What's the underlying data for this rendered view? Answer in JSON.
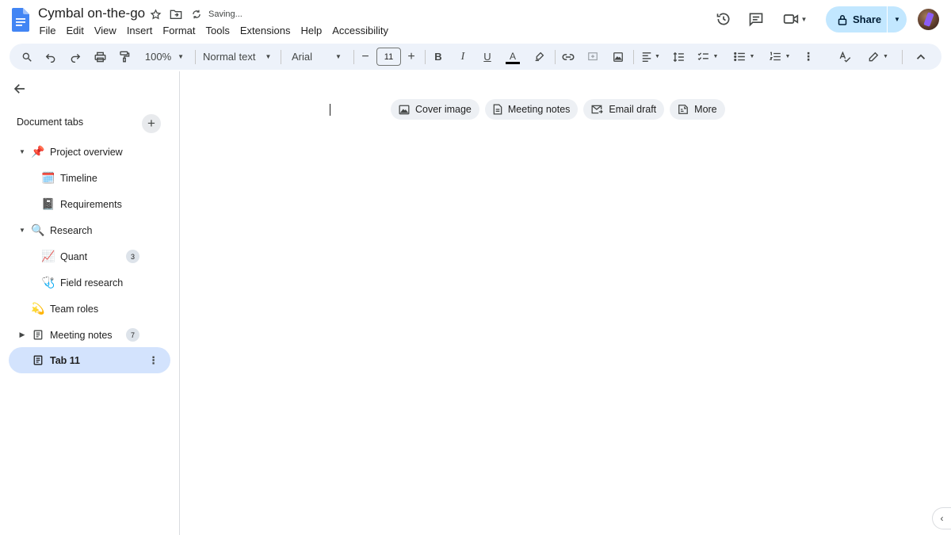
{
  "app": {
    "doc_title": "Cymbal on-the-go",
    "status": "Saving..."
  },
  "menu": [
    "File",
    "Edit",
    "View",
    "Insert",
    "Format",
    "Tools",
    "Extensions",
    "Help",
    "Accessibility"
  ],
  "header_actions": {
    "share_label": "Share"
  },
  "toolbar": {
    "zoom": "100%",
    "paragraph_style": "Normal text",
    "font": "Arial",
    "font_size": "11"
  },
  "sidebar": {
    "heading": "Document tabs",
    "add_icon": "plus-icon",
    "tabs": [
      {
        "label": "Project overview",
        "icon": "📌",
        "level": 0,
        "expander": "expanded"
      },
      {
        "label": "Timeline",
        "icon": "🗓️",
        "level": 1
      },
      {
        "label": "Requirements",
        "icon": "📓",
        "level": 1
      },
      {
        "label": "Research",
        "icon": "🔍",
        "level": 0,
        "expander": "expanded"
      },
      {
        "label": "Quant",
        "icon": "📈",
        "level": 1,
        "count": "3"
      },
      {
        "label": "Field research",
        "icon": "🩺",
        "level": 1
      },
      {
        "label": "Team roles",
        "icon": "💫",
        "level": 0
      },
      {
        "label": "Meeting notes",
        "icon": "document-icon",
        "level": 0,
        "expander": "collapsed",
        "count": "7"
      },
      {
        "label": "Tab 11",
        "icon": "document-icon",
        "level": 0,
        "active": true
      }
    ]
  },
  "canvas": {
    "chips": [
      {
        "label": "Cover image",
        "icon": "image-icon"
      },
      {
        "label": "Meeting notes",
        "icon": "document-icon"
      },
      {
        "label": "Email draft",
        "icon": "email-icon"
      },
      {
        "label": "More",
        "icon": "more-icon"
      }
    ]
  },
  "colors": {
    "toolbar_bg": "#edf2fa",
    "share_bg": "#c2e7ff",
    "active_tab_bg": "#d3e3fd",
    "docs_blue": "#4285f4"
  }
}
